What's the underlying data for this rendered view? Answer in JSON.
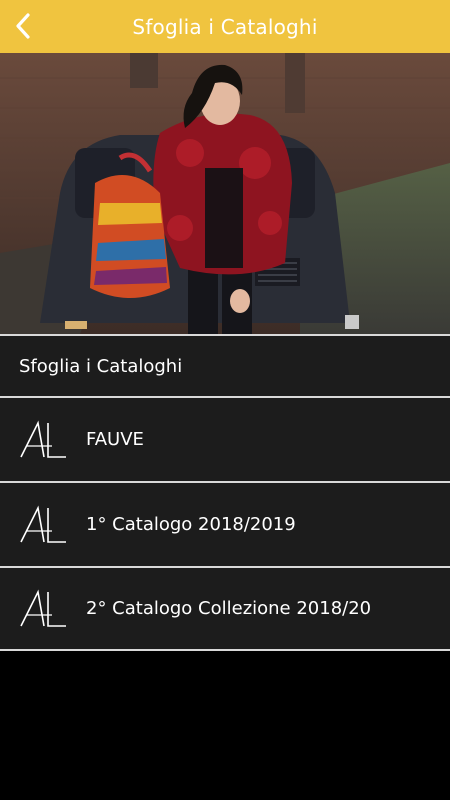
{
  "header": {
    "title": "Sfoglia i Cataloghi",
    "back_icon": "chevron-left-icon"
  },
  "hero": {
    "description_icon": "hero-photo"
  },
  "section": {
    "title": "Sfoglia i Cataloghi"
  },
  "catalogs": [
    {
      "label": "FAUVE",
      "icon": "al-logo-icon"
    },
    {
      "label": "1° Catalogo 2018/2019",
      "icon": "al-logo-icon"
    },
    {
      "label": "2° Catalogo Collezione 2018/20",
      "icon": "al-logo-icon"
    }
  ],
  "colors": {
    "header_bg": "#f0c43f",
    "row_bg": "#1c1c1c",
    "divider": "#d9d9d9",
    "page_bg": "#000000"
  }
}
